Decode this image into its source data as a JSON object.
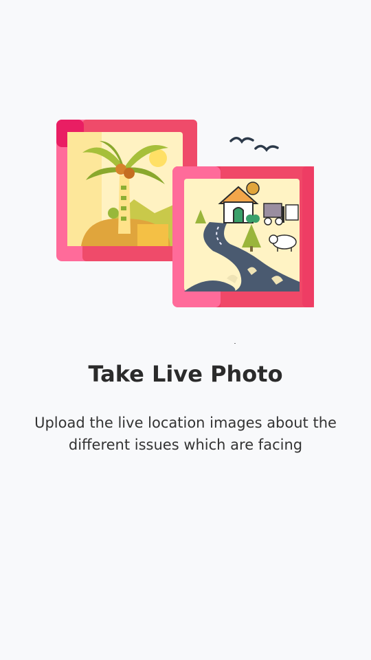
{
  "onboarding": {
    "title": "Take Live Photo",
    "description": "Upload the live location images about the different issues which are facing"
  },
  "illustration": {
    "left_photo_icon": "palm-island-photo-icon",
    "right_photo_icon": "rural-road-photo-icon",
    "colors": {
      "frame_pink": "#ff6b9a",
      "frame_red": "#ee3d64",
      "photo_bg": "#fff3c4",
      "road": "#4a5a70"
    }
  }
}
